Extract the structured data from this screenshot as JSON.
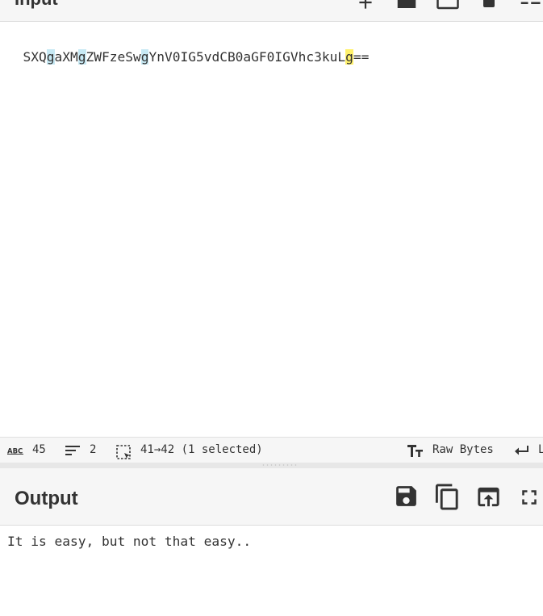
{
  "input": {
    "title": "Input",
    "text_segments": [
      {
        "text": "SXQ",
        "hl": ""
      },
      {
        "text": "g",
        "hl": "blue"
      },
      {
        "text": "aXM",
        "hl": ""
      },
      {
        "text": "g",
        "hl": "blue"
      },
      {
        "text": "ZWFzeSw",
        "hl": ""
      },
      {
        "text": "g",
        "hl": "blue"
      },
      {
        "text": "YnV0IG5vdCB0aGF0IGVhc3kuL",
        "hl": ""
      },
      {
        "text": "g",
        "hl": "yellow"
      },
      {
        "text": "==",
        "hl": ""
      }
    ],
    "header_icons": [
      "add-icon",
      "open-folder-icon",
      "new-tab-icon",
      "delete-icon",
      "layout-icon"
    ]
  },
  "status": {
    "length_icon": "abc-icon",
    "length": "45",
    "lines_icon": "lines-icon",
    "lines": "2",
    "selection_icon": "selection-icon",
    "selection": "41→42 (1 selected)",
    "encoding_icon": "text-format-icon",
    "encoding": "Raw Bytes",
    "eol_icon": "return-icon",
    "eol": "LF"
  },
  "output": {
    "title": "Output",
    "text": "It is easy, but not that easy..",
    "header_icons": [
      "save-icon",
      "copy-icon",
      "replace-input-icon",
      "fullscreen-icon"
    ]
  },
  "colors": {
    "highlight_blue": "#c7e9f4",
    "highlight_yellow": "#fff16b",
    "panel_bg": "#f6f6f6",
    "icon": "#333333"
  }
}
